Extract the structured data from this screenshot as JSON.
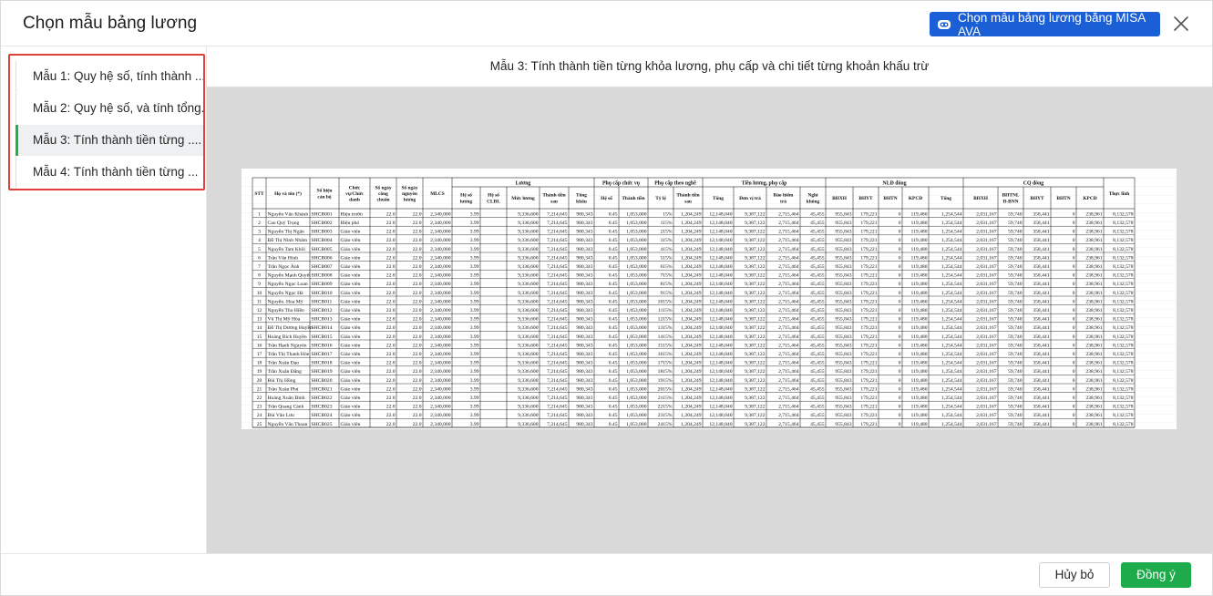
{
  "dialog": {
    "title": "Chọn mẫu bảng lương",
    "ava_button_label": "Chọn mẫu bảng lương bằng MISA AVA",
    "ava_icon": "robot-icon",
    "close_icon": "close-icon"
  },
  "templates": [
    {
      "label": "Mẫu 1: Quy hệ số, tính thành ..."
    },
    {
      "label": "Mẫu 2: Quy hệ số, và tính tổng..."
    },
    {
      "label": "Mẫu 3: Tính thành tiền từng ...."
    },
    {
      "label": "Mẫu 4: Tính thành tiền từng ..."
    }
  ],
  "selected_template_index": 2,
  "preview": {
    "title": "Mẫu 3: Tính thành tiền từng khỏa lương, phụ cấp và chi tiết từng khoản khấu trừ",
    "table": {
      "group_headers": [
        "Lương",
        "Phụ cấp chức vụ",
        "Phụ cấp theo nghề",
        "Tiền lương, phụ cấp",
        "NLĐ đóng",
        "CQ đóng"
      ],
      "columns": [
        "STT",
        "Họ và tên (*)",
        "Số hiệu cán bộ",
        "Chức vụ/Chức danh",
        "Số ngày công chuẩn",
        "Số ngày nguyên lương",
        "MLCS",
        "Hệ số lương",
        "Hệ số CLBL",
        "Mức lương",
        "Thành tiền sau",
        "Tổng khấu",
        "Hệ số",
        "Thành tiền",
        "Tỷ lệ",
        "Thành tiền sau",
        "Tổng",
        "Đơn vị trả",
        "Bảo hiểm trả",
        "Nghỉ không",
        "BHXH",
        "BHYT",
        "BHTN",
        "KPCĐ",
        "Tổng",
        "BHXH",
        "BHTNL Đ-BNN",
        "BHYT",
        "BHTN",
        "KPCĐ",
        "Thực lĩnh"
      ],
      "names": [
        "Nguyễn Văn Khánh",
        "Cao Quý Trọng",
        "Nguyễn Thị Ngân",
        "Đỗ Thị Ninh Nhâm",
        "Nguyễn Tam Khôi",
        "Trần Văn Hinh",
        "Trần Ngọc Ánh",
        "Nguyễn Mạnh Quyết",
        "Nguyễn Ngọc Loan",
        "Nguyễn Ngọc Hà",
        "Nguyễn. Hoa Mỹ",
        "Nguyễn Thu Hiền",
        "Vũ Thị Mỹ Hòa",
        "Đỗ Thị Dương Huyền",
        "Hoàng Bích Huyền",
        "Trần Hạnh Nguyên",
        "Trần Thị Thanh Hòe",
        "Trần Xuân Đạo",
        "Trần Xuân Đăng",
        "Bùi Thị Hồng",
        "Trần Xuân Phú",
        "Hoàng Xuân Đình",
        "Trần Quang Cảnh",
        "Bùi Văn Lưu",
        "Nguyễn Văn Thoan"
      ],
      "codes_prefix": "SHCB0",
      "roles": [
        "Hiệu trưởn",
        "Hiệu phó",
        "Giáo viên"
      ],
      "row_values": {
        "ngay_cong_chuan": "22.0",
        "ngay_nguyen_luong": "22.0",
        "mlcs": "2,340,000",
        "he_so_luong": "3.99",
        "muc_luong": "9,336,600",
        "thanh_tien_sau": "7,214,645",
        "tong_khau": "980,343",
        "he_so_pc": "0.45",
        "thanh_tien_pc": "1,053,000",
        "thanh_tien_nghe": "1,204,249",
        "tong_tl": "12,148,040",
        "don_vi_tra": "9,387,122",
        "bao_hiem_tra": "2,715,464",
        "nghi_khong": "45,455",
        "bhxh_nld": "955,843",
        "bhyt_nld": "179,221",
        "bhtn_nld": "0",
        "kpcd_nld": "119,480",
        "tong_nld": "1,254,544",
        "bhxh_cq": "2,031,167",
        "bhtnl_cq": "59,740",
        "bhyt_cq": "358,441",
        "bhtn_cq": "0",
        "kpcd_cq": "238,961",
        "thuc_linh": "8,132,578"
      },
      "ty_le": [
        "15%",
        "115%",
        "215%",
        "315%",
        "415%",
        "515%",
        "615%",
        "715%",
        "815%",
        "915%",
        "1015%",
        "1115%",
        "1215%",
        "1315%",
        "1415%",
        "1515%",
        "1615%",
        "1715%",
        "1815%",
        "1915%",
        "2015%",
        "2115%",
        "2215%",
        "2315%",
        "2415%"
      ]
    }
  },
  "footer": {
    "cancel_label": "Hủy bỏ",
    "ok_label": "Đồng ý"
  }
}
